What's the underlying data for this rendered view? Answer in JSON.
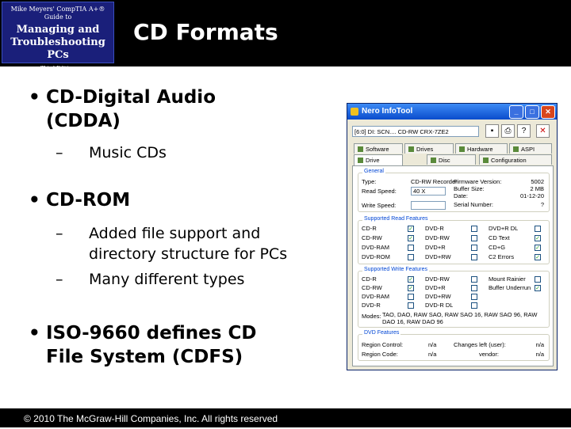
{
  "header": {
    "logo": {
      "line1": "Mike Meyers' CompTIA A+® Guide to",
      "line2": "Managing and Troubleshooting PCs",
      "line3": "Third Edition"
    },
    "title": "CD Formats"
  },
  "bullets": [
    {
      "text": "CD-Digital Audio",
      "cont": "(CDDA)",
      "subs": [
        "Music CDs"
      ]
    },
    {
      "text": "CD-ROM",
      "subs": [
        "Added file support and",
        "directory structure for PCs",
        "Many different types"
      ]
    },
    {
      "text": "ISO-9660 defines CD",
      "cont": "File System (CDFS)"
    }
  ],
  "footer": {
    "text": "© 2010 The McGraw-Hill Companies, Inc. All rights reserved"
  },
  "window": {
    "title": "Nero InfoTool",
    "device": "[6:0] DI: SCN.... CD-RW CRX-7ZE2",
    "tabs": [
      "Software",
      "Drives",
      "Hardware",
      "ASPI",
      "Drive",
      "Disc",
      "Configuration"
    ],
    "general": {
      "label": "General",
      "type_label": "Type:",
      "type_value": "CD-RW Recorder",
      "read_label": "Read Speed:",
      "read_value": "40 X",
      "write_label": "Write Speed:",
      "write_value": "",
      "fw_label": "Firmware Version:",
      "fw_value": "5002",
      "buf_label": "Buffer Size:",
      "buf_value": "2 MB",
      "date_label": "Date:",
      "date_value": "01-12-20",
      "serial_label": "Serial Number:",
      "serial_value": "?"
    },
    "read_features": {
      "label": "Supported Read Features",
      "items": [
        {
          "name": "CD-R",
          "checked": true
        },
        {
          "name": "CD-RW",
          "checked": true
        },
        {
          "name": "DVD-RAM",
          "checked": false
        },
        {
          "name": "DVD-ROM",
          "checked": false
        },
        {
          "name": "DVD-R",
          "checked": false
        },
        {
          "name": "DVD-RW",
          "checked": false
        },
        {
          "name": "DVD+R",
          "checked": false
        },
        {
          "name": "DVD+RW",
          "checked": false
        },
        {
          "name": "DVD+R DL",
          "checked": false
        },
        {
          "name": "CD Text",
          "checked": true
        },
        {
          "name": "CD+G",
          "checked": true
        },
        {
          "name": "C2 Errors",
          "checked": true
        }
      ]
    },
    "write_features": {
      "label": "Supported Write Features",
      "items": [
        {
          "name": "CD-R",
          "checked": true
        },
        {
          "name": "CD-RW",
          "checked": true
        },
        {
          "name": "DVD-RAM",
          "checked": false
        },
        {
          "name": "DVD-R",
          "checked": false
        },
        {
          "name": "DVD-RW",
          "checked": false
        },
        {
          "name": "DVD+R",
          "checked": false
        },
        {
          "name": "DVD+RW",
          "checked": false
        },
        {
          "name": "DVD-R DL",
          "checked": false
        },
        {
          "name": "Mount Rainier",
          "checked": false
        },
        {
          "name": "Buffer Underrun Protection",
          "checked": true
        }
      ],
      "modes_label": "Modes:",
      "modes_value": "TAO, DAO, RAW SAO, RAW SAO 16, RAW SAO 96, RAW DAO 16, RAW DAO 96"
    },
    "dvd_features": {
      "label": "DVD Features",
      "region_label": "Region Control:",
      "region_value": "n/a",
      "changes_label": "Changes left (user):",
      "changes_value": "n/a",
      "code_label": "Region Code:",
      "code_value": "n/a",
      "vendor_label": "vendor:",
      "vendor_value": "n/a"
    }
  }
}
